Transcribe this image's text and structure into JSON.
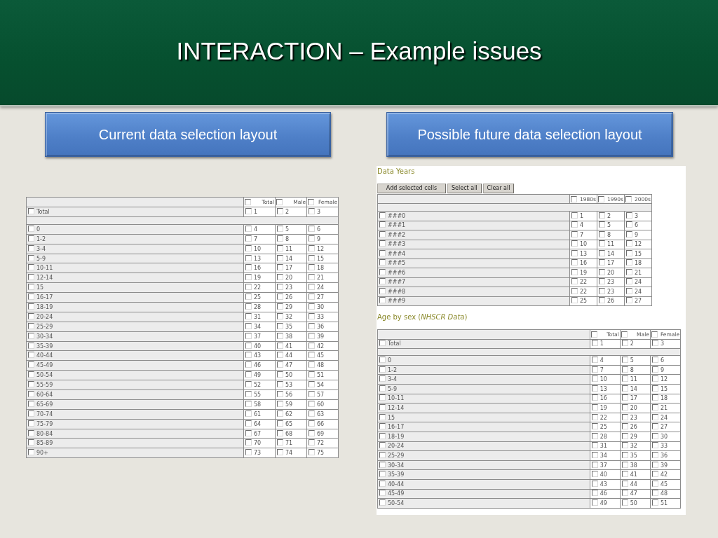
{
  "slide": {
    "title": "INTERACTION – Example issues"
  },
  "layouts": [
    {
      "caption": "Current data selection layout",
      "sections": [
        {
          "table": {
            "columns": [
              {
                "label": "Total",
                "checked": false
              },
              {
                "label": "Male",
                "checked": false
              },
              {
                "label": "Female",
                "checked": false
              }
            ],
            "rows": [
              {
                "kind": "data",
                "label": "Total",
                "checked": false,
                "cells": [
                  {
                    "value": "1",
                    "checked": false
                  },
                  {
                    "value": "2",
                    "checked": false
                  },
                  {
                    "value": "3",
                    "checked": false
                  }
                ]
              },
              {
                "kind": "spacer"
              },
              {
                "kind": "data",
                "label": "0",
                "checked": false,
                "cells": [
                  {
                    "value": "4",
                    "checked": false
                  },
                  {
                    "value": "5",
                    "checked": false
                  },
                  {
                    "value": "6",
                    "checked": false
                  }
                ]
              },
              {
                "kind": "data",
                "label": "1-2",
                "checked": false,
                "cells": [
                  {
                    "value": "7",
                    "checked": false
                  },
                  {
                    "value": "8",
                    "checked": false
                  },
                  {
                    "value": "9",
                    "checked": false
                  }
                ]
              },
              {
                "kind": "data",
                "label": "3-4",
                "checked": false,
                "cells": [
                  {
                    "value": "10",
                    "checked": false
                  },
                  {
                    "value": "11",
                    "checked": false
                  },
                  {
                    "value": "12",
                    "checked": false
                  }
                ]
              },
              {
                "kind": "data",
                "label": "5-9",
                "checked": false,
                "cells": [
                  {
                    "value": "13",
                    "checked": false
                  },
                  {
                    "value": "14",
                    "checked": false
                  },
                  {
                    "value": "15",
                    "checked": false
                  }
                ]
              },
              {
                "kind": "data",
                "label": "10-11",
                "checked": false,
                "cells": [
                  {
                    "value": "16",
                    "checked": false
                  },
                  {
                    "value": "17",
                    "checked": false
                  },
                  {
                    "value": "18",
                    "checked": false
                  }
                ]
              },
              {
                "kind": "data",
                "label": "12-14",
                "checked": false,
                "cells": [
                  {
                    "value": "19",
                    "checked": false
                  },
                  {
                    "value": "20",
                    "checked": false
                  },
                  {
                    "value": "21",
                    "checked": false
                  }
                ]
              },
              {
                "kind": "data",
                "label": "15",
                "checked": false,
                "cells": [
                  {
                    "value": "22",
                    "checked": false
                  },
                  {
                    "value": "23",
                    "checked": false
                  },
                  {
                    "value": "24",
                    "checked": false
                  }
                ]
              },
              {
                "kind": "data",
                "label": "16-17",
                "checked": false,
                "cells": [
                  {
                    "value": "25",
                    "checked": false
                  },
                  {
                    "value": "26",
                    "checked": false
                  },
                  {
                    "value": "27",
                    "checked": false
                  }
                ]
              },
              {
                "kind": "data",
                "label": "18-19",
                "checked": false,
                "cells": [
                  {
                    "value": "28",
                    "checked": false
                  },
                  {
                    "value": "29",
                    "checked": false
                  },
                  {
                    "value": "30",
                    "checked": false
                  }
                ]
              },
              {
                "kind": "data",
                "label": "20-24",
                "checked": false,
                "cells": [
                  {
                    "value": "31",
                    "checked": false
                  },
                  {
                    "value": "32",
                    "checked": false
                  },
                  {
                    "value": "33",
                    "checked": false
                  }
                ]
              },
              {
                "kind": "data",
                "label": "25-29",
                "checked": false,
                "cells": [
                  {
                    "value": "34",
                    "checked": false
                  },
                  {
                    "value": "35",
                    "checked": false
                  },
                  {
                    "value": "36",
                    "checked": false
                  }
                ]
              },
              {
                "kind": "data",
                "label": "30-34",
                "checked": false,
                "cells": [
                  {
                    "value": "37",
                    "checked": false
                  },
                  {
                    "value": "38",
                    "checked": false
                  },
                  {
                    "value": "39",
                    "checked": false
                  }
                ]
              },
              {
                "kind": "data",
                "label": "35-39",
                "checked": false,
                "cells": [
                  {
                    "value": "40",
                    "checked": false
                  },
                  {
                    "value": "41",
                    "checked": false
                  },
                  {
                    "value": "42",
                    "checked": false
                  }
                ]
              },
              {
                "kind": "data",
                "label": "40-44",
                "checked": false,
                "cells": [
                  {
                    "value": "43",
                    "checked": false
                  },
                  {
                    "value": "44",
                    "checked": false
                  },
                  {
                    "value": "45",
                    "checked": false
                  }
                ]
              },
              {
                "kind": "data",
                "label": "45-49",
                "checked": false,
                "cells": [
                  {
                    "value": "46",
                    "checked": false
                  },
                  {
                    "value": "47",
                    "checked": false
                  },
                  {
                    "value": "48",
                    "checked": false
                  }
                ]
              },
              {
                "kind": "data",
                "label": "50-54",
                "checked": false,
                "cells": [
                  {
                    "value": "49",
                    "checked": false
                  },
                  {
                    "value": "50",
                    "checked": false
                  },
                  {
                    "value": "51",
                    "checked": false
                  }
                ]
              },
              {
                "kind": "data",
                "label": "55-59",
                "checked": false,
                "cells": [
                  {
                    "value": "52",
                    "checked": false
                  },
                  {
                    "value": "53",
                    "checked": false
                  },
                  {
                    "value": "54",
                    "checked": false
                  }
                ]
              },
              {
                "kind": "data",
                "label": "60-64",
                "checked": false,
                "cells": [
                  {
                    "value": "55",
                    "checked": false
                  },
                  {
                    "value": "56",
                    "checked": false
                  },
                  {
                    "value": "57",
                    "checked": false
                  }
                ]
              },
              {
                "kind": "data",
                "label": "65-69",
                "checked": false,
                "cells": [
                  {
                    "value": "58",
                    "checked": false
                  },
                  {
                    "value": "59",
                    "checked": false
                  },
                  {
                    "value": "60",
                    "checked": false
                  }
                ]
              },
              {
                "kind": "data",
                "label": "70-74",
                "checked": false,
                "cells": [
                  {
                    "value": "61",
                    "checked": false
                  },
                  {
                    "value": "62",
                    "checked": false
                  },
                  {
                    "value": "63",
                    "checked": false
                  }
                ]
              },
              {
                "kind": "data",
                "label": "75-79",
                "checked": false,
                "cells": [
                  {
                    "value": "64",
                    "checked": false
                  },
                  {
                    "value": "65",
                    "checked": false
                  },
                  {
                    "value": "66",
                    "checked": false
                  }
                ]
              },
              {
                "kind": "data",
                "label": "80-84",
                "checked": false,
                "cells": [
                  {
                    "value": "67",
                    "checked": false
                  },
                  {
                    "value": "68",
                    "checked": false
                  },
                  {
                    "value": "69",
                    "checked": false
                  }
                ]
              },
              {
                "kind": "data",
                "label": "85-89",
                "checked": false,
                "cells": [
                  {
                    "value": "70",
                    "checked": false
                  },
                  {
                    "value": "71",
                    "checked": false
                  },
                  {
                    "value": "72",
                    "checked": false
                  }
                ]
              },
              {
                "kind": "data",
                "label": "90+",
                "checked": false,
                "cells": [
                  {
                    "value": "73",
                    "checked": false
                  },
                  {
                    "value": "74",
                    "checked": false
                  },
                  {
                    "value": "75",
                    "checked": false
                  }
                ]
              }
            ]
          }
        }
      ]
    },
    {
      "caption": "Possible future data selection layout",
      "sections": [
        {
          "title": "Data Years",
          "buttons": [
            {
              "label": "Add selected cells"
            },
            {
              "label": "Select all"
            },
            {
              "label": "Clear all"
            }
          ],
          "table": {
            "columns": [
              {
                "label": "1980s",
                "checked": false
              },
              {
                "label": "1990s",
                "checked": false
              },
              {
                "label": "2000s",
                "checked": false
              }
            ],
            "rows": [
              {
                "kind": "spacer"
              },
              {
                "kind": "data",
                "label": "###0",
                "checked": false,
                "cells": [
                  {
                    "value": "1",
                    "checked": false
                  },
                  {
                    "value": "2",
                    "checked": false
                  },
                  {
                    "value": "3",
                    "checked": false
                  }
                ]
              },
              {
                "kind": "data",
                "label": "###1",
                "checked": false,
                "cells": [
                  {
                    "value": "4",
                    "checked": false
                  },
                  {
                    "value": "5",
                    "checked": false
                  },
                  {
                    "value": "6",
                    "checked": false
                  }
                ]
              },
              {
                "kind": "data",
                "label": "###2",
                "checked": false,
                "cells": [
                  {
                    "value": "7",
                    "checked": false
                  },
                  {
                    "value": "8",
                    "checked": false
                  },
                  {
                    "value": "9",
                    "checked": false
                  }
                ]
              },
              {
                "kind": "data",
                "label": "###3",
                "checked": false,
                "cells": [
                  {
                    "value": "10",
                    "checked": false
                  },
                  {
                    "value": "11",
                    "checked": false
                  },
                  {
                    "value": "12",
                    "checked": false
                  }
                ]
              },
              {
                "kind": "data",
                "label": "###4",
                "checked": false,
                "cells": [
                  {
                    "value": "13",
                    "checked": false
                  },
                  {
                    "value": "14",
                    "checked": false
                  },
                  {
                    "value": "15",
                    "checked": false
                  }
                ]
              },
              {
                "kind": "data",
                "label": "###5",
                "checked": false,
                "cells": [
                  {
                    "value": "16",
                    "checked": false
                  },
                  {
                    "value": "17",
                    "checked": false
                  },
                  {
                    "value": "18",
                    "checked": false
                  }
                ]
              },
              {
                "kind": "data",
                "label": "###6",
                "checked": false,
                "cells": [
                  {
                    "value": "19",
                    "checked": false
                  },
                  {
                    "value": "20",
                    "checked": false
                  },
                  {
                    "value": "21",
                    "checked": false
                  }
                ]
              },
              {
                "kind": "data",
                "label": "###7",
                "checked": false,
                "cells": [
                  {
                    "value": "22",
                    "checked": false
                  },
                  {
                    "value": "23",
                    "checked": false
                  },
                  {
                    "value": "24",
                    "checked": false
                  }
                ]
              },
              {
                "kind": "data",
                "label": "###8",
                "checked": false,
                "cells": [
                  {
                    "value": "22",
                    "checked": false
                  },
                  {
                    "value": "23",
                    "checked": false
                  },
                  {
                    "value": "24",
                    "checked": false
                  }
                ]
              },
              {
                "kind": "data",
                "label": "###9",
                "checked": false,
                "cells": [
                  {
                    "value": "25",
                    "checked": false
                  },
                  {
                    "value": "26",
                    "checked": false
                  },
                  {
                    "value": "27",
                    "checked": false
                  }
                ]
              }
            ]
          }
        },
        {
          "title": "Age by sex (*NHSCR Data*)",
          "table": {
            "columns": [
              {
                "label": "Total",
                "checked": false
              },
              {
                "label": "Male",
                "checked": false
              },
              {
                "label": "Female",
                "checked": false
              }
            ],
            "rows": [
              {
                "kind": "data",
                "label": "Total",
                "checked": false,
                "cells": [
                  {
                    "value": "1",
                    "checked": false
                  },
                  {
                    "value": "2",
                    "checked": false
                  },
                  {
                    "value": "3",
                    "checked": false
                  }
                ]
              },
              {
                "kind": "spacer"
              },
              {
                "kind": "data",
                "label": "0",
                "checked": false,
                "cells": [
                  {
                    "value": "4",
                    "checked": false
                  },
                  {
                    "value": "5",
                    "checked": false
                  },
                  {
                    "value": "6",
                    "checked": false
                  }
                ]
              },
              {
                "kind": "data",
                "label": "1-2",
                "checked": false,
                "cells": [
                  {
                    "value": "7",
                    "checked": false
                  },
                  {
                    "value": "8",
                    "checked": false
                  },
                  {
                    "value": "9",
                    "checked": false
                  }
                ]
              },
              {
                "kind": "data",
                "label": "3-4",
                "checked": false,
                "cells": [
                  {
                    "value": "10",
                    "checked": false
                  },
                  {
                    "value": "11",
                    "checked": false
                  },
                  {
                    "value": "12",
                    "checked": false
                  }
                ]
              },
              {
                "kind": "data",
                "label": "5-9",
                "checked": false,
                "cells": [
                  {
                    "value": "13",
                    "checked": false
                  },
                  {
                    "value": "14",
                    "checked": false
                  },
                  {
                    "value": "15",
                    "checked": false
                  }
                ]
              },
              {
                "kind": "data",
                "label": "10-11",
                "checked": false,
                "cells": [
                  {
                    "value": "16",
                    "checked": false
                  },
                  {
                    "value": "17",
                    "checked": false
                  },
                  {
                    "value": "18",
                    "checked": false
                  }
                ]
              },
              {
                "kind": "data",
                "label": "12-14",
                "checked": false,
                "cells": [
                  {
                    "value": "19",
                    "checked": false
                  },
                  {
                    "value": "20",
                    "checked": false
                  },
                  {
                    "value": "21",
                    "checked": false
                  }
                ]
              },
              {
                "kind": "data",
                "label": "15",
                "checked": false,
                "cells": [
                  {
                    "value": "22",
                    "checked": false
                  },
                  {
                    "value": "23",
                    "checked": false
                  },
                  {
                    "value": "24",
                    "checked": false
                  }
                ]
              },
              {
                "kind": "data",
                "label": "16-17",
                "checked": false,
                "cells": [
                  {
                    "value": "25",
                    "checked": false
                  },
                  {
                    "value": "26",
                    "checked": false
                  },
                  {
                    "value": "27",
                    "checked": false
                  }
                ]
              },
              {
                "kind": "data",
                "label": "18-19",
                "checked": false,
                "cells": [
                  {
                    "value": "28",
                    "checked": false
                  },
                  {
                    "value": "29",
                    "checked": false
                  },
                  {
                    "value": "30",
                    "checked": false
                  }
                ]
              },
              {
                "kind": "data",
                "label": "20-24",
                "checked": false,
                "cells": [
                  {
                    "value": "31",
                    "checked": false
                  },
                  {
                    "value": "32",
                    "checked": false
                  },
                  {
                    "value": "33",
                    "checked": false
                  }
                ]
              },
              {
                "kind": "data",
                "label": "25-29",
                "checked": false,
                "cells": [
                  {
                    "value": "34",
                    "checked": false
                  },
                  {
                    "value": "35",
                    "checked": false
                  },
                  {
                    "value": "36",
                    "checked": false
                  }
                ]
              },
              {
                "kind": "data",
                "label": "30-34",
                "checked": false,
                "cells": [
                  {
                    "value": "37",
                    "checked": false
                  },
                  {
                    "value": "38",
                    "checked": false
                  },
                  {
                    "value": "39",
                    "checked": false
                  }
                ]
              },
              {
                "kind": "data",
                "label": "35-39",
                "checked": false,
                "cells": [
                  {
                    "value": "40",
                    "checked": false
                  },
                  {
                    "value": "41",
                    "checked": false
                  },
                  {
                    "value": "42",
                    "checked": false
                  }
                ]
              },
              {
                "kind": "data",
                "label": "40-44",
                "checked": false,
                "cells": [
                  {
                    "value": "43",
                    "checked": false
                  },
                  {
                    "value": "44",
                    "checked": false
                  },
                  {
                    "value": "45",
                    "checked": false
                  }
                ]
              },
              {
                "kind": "data",
                "label": "45-49",
                "checked": false,
                "cells": [
                  {
                    "value": "46",
                    "checked": false
                  },
                  {
                    "value": "47",
                    "checked": false
                  },
                  {
                    "value": "48",
                    "checked": false
                  }
                ]
              },
              {
                "kind": "data",
                "label": "50-54",
                "checked": false,
                "cells": [
                  {
                    "value": "49",
                    "checked": false
                  },
                  {
                    "value": "50",
                    "checked": false
                  },
                  {
                    "value": "51",
                    "checked": false
                  }
                ]
              }
            ]
          }
        }
      ]
    }
  ]
}
